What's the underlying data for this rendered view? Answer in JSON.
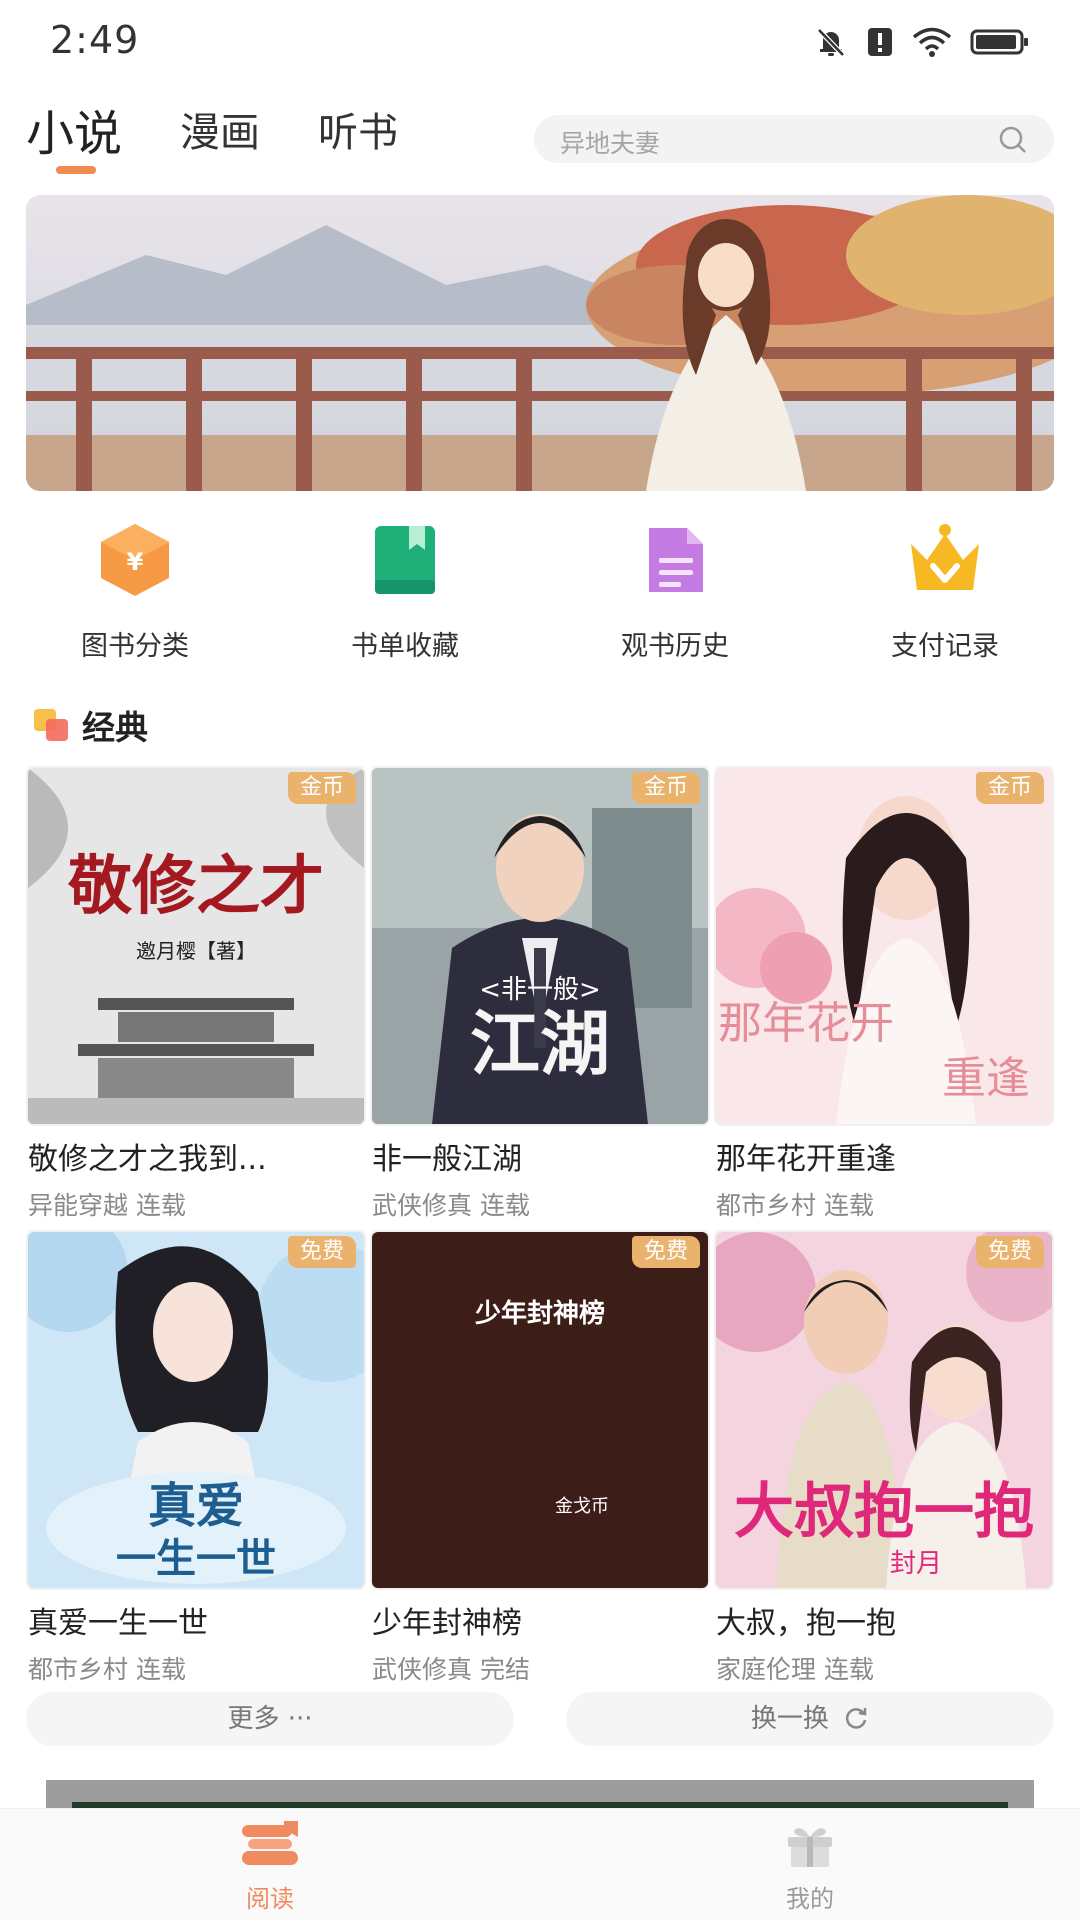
{
  "status": {
    "time": "2:49"
  },
  "tabs": [
    {
      "label": "小说",
      "active": true
    },
    {
      "label": "漫画",
      "active": false
    },
    {
      "label": "听书",
      "active": false
    }
  ],
  "search": {
    "placeholder": "异地夫妻"
  },
  "quick_entries": [
    {
      "label": "图书分类",
      "icon": "category-hexagon-icon"
    },
    {
      "label": "书单收藏",
      "icon": "bookmark-book-icon"
    },
    {
      "label": "观书历史",
      "icon": "history-document-icon"
    },
    {
      "label": "支付记录",
      "icon": "crown-icon"
    }
  ],
  "section": {
    "title": "经典"
  },
  "books": [
    {
      "title": "敬修之才之我到...",
      "genre": "异能穿越",
      "status": "连载",
      "tag": "金币",
      "cover_text": "敬修之才",
      "cover_subtext": "邀月樱【著】"
    },
    {
      "title": "非一般江湖",
      "genre": "武侠修真",
      "status": "连载",
      "tag": "金币",
      "cover_text": "江湖",
      "cover_subtext": "<非一般>"
    },
    {
      "title": "那年花开重逢",
      "genre": "都市乡村",
      "status": "连载",
      "tag": "金币",
      "cover_text": "那年花开",
      "cover_subtext": "重逢"
    },
    {
      "title": "真爱一生一世",
      "genre": "都市乡村",
      "status": "连载",
      "tag": "免费",
      "cover_text": "真爱",
      "cover_subtext": "一生一世"
    },
    {
      "title": "少年封神榜",
      "genre": "武侠修真",
      "status": "完结",
      "tag": "免费",
      "cover_text": "少年封神榜",
      "cover_subtext": "金戈币"
    },
    {
      "title": "大叔，抱一抱",
      "genre": "家庭伦理",
      "status": "连载",
      "tag": "免费",
      "cover_text": "大叔抱一抱",
      "cover_subtext": "封月"
    }
  ],
  "actions": {
    "more": "更多 ···",
    "refresh": "换一换"
  },
  "bottom_nav": [
    {
      "label": "阅读",
      "active": true,
      "color": "#f08a60"
    },
    {
      "label": "我的",
      "active": false,
      "color": "#9a9a9a"
    }
  ],
  "colors": {
    "accent": "#f08a4f",
    "tag_bg": "#e9b36d"
  }
}
